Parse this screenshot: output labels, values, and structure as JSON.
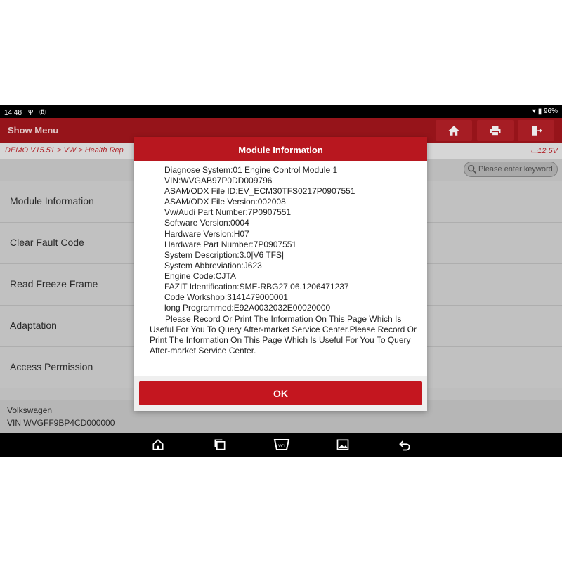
{
  "statusbar": {
    "time": "14:48",
    "icon1": "Ψ",
    "icon2": "Ⓑ",
    "battery": "96%"
  },
  "appbar": {
    "title": "Show Menu"
  },
  "breadcrumb": {
    "path": "DEMO V15.51 > VW > Health Rep",
    "battery_voltage": "12.5V"
  },
  "search": {
    "placeholder": "Please enter keyword"
  },
  "menu": {
    "items": [
      {
        "label": "Module Information"
      },
      {
        "label": "Clear Fault Code"
      },
      {
        "label": "Read Freeze Frame"
      },
      {
        "label": "Adaptation"
      },
      {
        "label": "Access Permission"
      }
    ]
  },
  "footer": {
    "make": "Volkswagen",
    "vin": "VIN WVGFF9BP4CD000000"
  },
  "dialog": {
    "title": "Module Information",
    "lines": [
      "Diagnose System:01 Engine Control Module 1",
      "VIN:WVGAB97P0DD009796",
      "ASAM/ODX File ID:EV_ECM30TFS0217P0907551",
      "ASAM/ODX File Version:002008",
      "Vw/Audi Part Number:7P0907551",
      "Software Version:0004",
      "Hardware Version:H07",
      "Hardware Part Number:7P0907551",
      "System Description:3.0|V6 TFS|",
      "System Abbreviation:J623",
      "Engine Code:CJTA",
      "FAZIT Identification:SME-RBG27.06.1206471237",
      "Code Workshop:3141479000001",
      "long Programmed:E92A0032032E00020000"
    ],
    "note": "Please Record Or Print The Information On This Page Which Is Useful For You To Query After-market Service Center.Please Record Or Print The Information On This Page Which Is Useful For You To Query After-market Service Center.",
    "ok_label": "OK"
  },
  "colors": {
    "brand_red": "#b8171f",
    "crumb_red": "#c0282f"
  }
}
